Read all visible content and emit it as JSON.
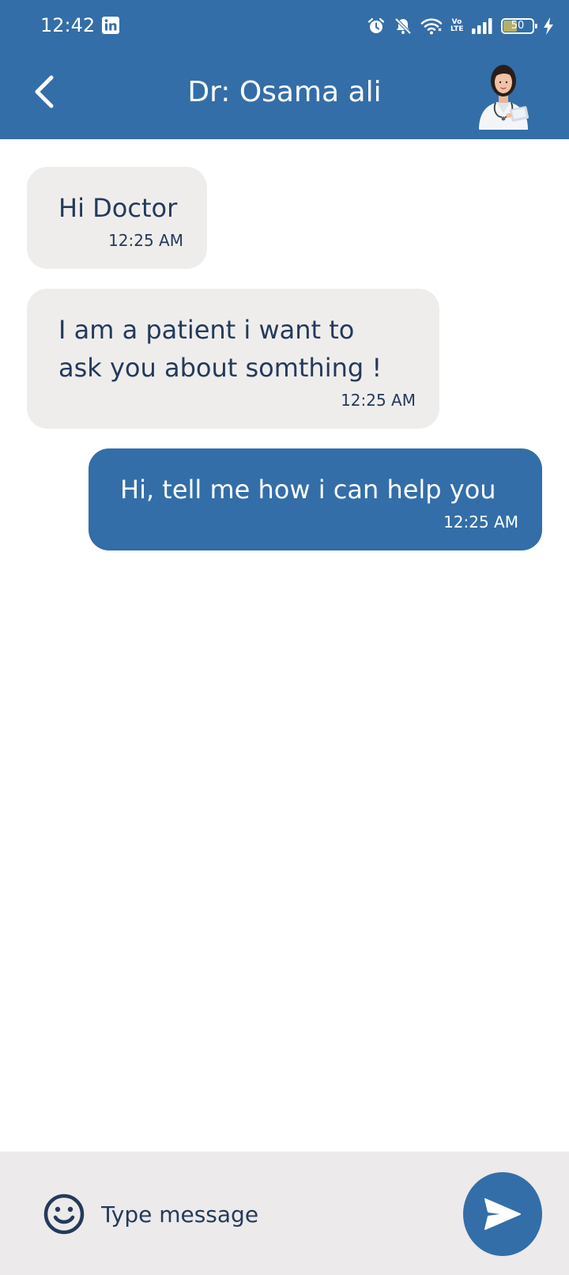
{
  "status_bar": {
    "time": "12:42",
    "app_icon": "linkedin-icon",
    "indicators": [
      "alarm-icon",
      "mute-icon",
      "wifi-icon",
      "volte-icon",
      "signal-icon",
      "battery-icon",
      "charging-icon"
    ],
    "volte_line1": "Vo",
    "volte_line2": "LTE",
    "battery_level": "50",
    "battery_fraction": 0.5
  },
  "header": {
    "back_icon": "chevron-left-icon",
    "title": "Dr: Osama ali",
    "avatar": "doctor-avatar"
  },
  "messages": [
    {
      "direction": "incoming",
      "text": "Hi Doctor",
      "time": "12:25 AM"
    },
    {
      "direction": "incoming",
      "text_lines": [
        "I am a patient i want to",
        "ask you about somthing !"
      ],
      "time": "12:25 AM"
    },
    {
      "direction": "outgoing",
      "text": "Hi, tell me how i can help you",
      "time": "12:25 AM"
    }
  ],
  "composer": {
    "emoji_icon": "smiley-icon",
    "placeholder": "Type message",
    "value": "",
    "send_icon": "send-icon"
  },
  "colors": {
    "primary": "#336ea8",
    "incoming_bubble": "#efedec",
    "text_dark": "#243a5a",
    "composer_bg": "#eceaea",
    "background": "#ffffff"
  }
}
